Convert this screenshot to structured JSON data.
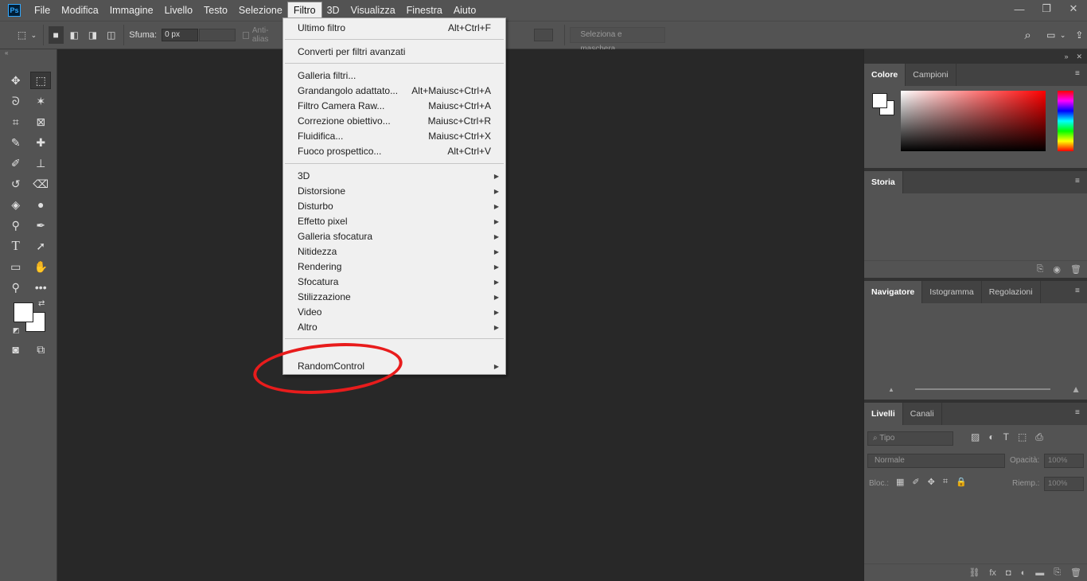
{
  "app": {
    "logo": "Ps"
  },
  "menubar": {
    "items": [
      "File",
      "Modifica",
      "Immagine",
      "Livello",
      "Testo",
      "Selezione",
      "Filtro",
      "3D",
      "Visualizza",
      "Finestra",
      "Aiuto"
    ],
    "active": "Filtro"
  },
  "options": {
    "sfuma_label": "Sfuma:",
    "sfuma_value": "0 px",
    "antialias_label": "Anti-alias",
    "select_mask_button": "Seleziona e maschera..."
  },
  "filter_menu": {
    "items": [
      {
        "label": "Ultimo filtro",
        "shortcut": "Alt+Ctrl+F"
      },
      {
        "label": "Converti per filtri avanzati",
        "shortcut": ""
      },
      {
        "label": "Galleria filtri...",
        "shortcut": ""
      },
      {
        "label": "Grandangolo adattato...",
        "shortcut": "Alt+Maiusc+Ctrl+A"
      },
      {
        "label": "Filtro Camera Raw...",
        "shortcut": "Maiusc+Ctrl+A"
      },
      {
        "label": "Correzione obiettivo...",
        "shortcut": "Maiusc+Ctrl+R"
      },
      {
        "label": "Fluidifica...",
        "shortcut": "Maiusc+Ctrl+X"
      },
      {
        "label": "Fuoco prospettico...",
        "shortcut": "Alt+Ctrl+V"
      },
      {
        "label": "3D",
        "shortcut": ""
      },
      {
        "label": "Distorsione",
        "shortcut": ""
      },
      {
        "label": "Disturbo",
        "shortcut": ""
      },
      {
        "label": "Effetto pixel",
        "shortcut": ""
      },
      {
        "label": "Galleria sfocatura",
        "shortcut": ""
      },
      {
        "label": "Nitidezza",
        "shortcut": ""
      },
      {
        "label": "Rendering",
        "shortcut": ""
      },
      {
        "label": "Sfocatura",
        "shortcut": ""
      },
      {
        "label": "Stilizzazione",
        "shortcut": ""
      },
      {
        "label": "Video",
        "shortcut": ""
      },
      {
        "label": "Altro",
        "shortcut": ""
      },
      {
        "label": "RandomControl",
        "shortcut": ""
      }
    ]
  },
  "panels": {
    "color": {
      "tabs": [
        "Colore",
        "Campioni"
      ]
    },
    "history": {
      "tabs": [
        "Storia"
      ]
    },
    "navigator": {
      "tabs": [
        "Navigatore",
        "Istogramma",
        "Regolazioni"
      ]
    },
    "layers": {
      "tabs": [
        "Livelli",
        "Canali"
      ],
      "search_placeholder": "Tipo",
      "blend_mode": "Normale",
      "opacity_label": "Opacità:",
      "opacity_value": "100%",
      "lock_label": "Bloc.:",
      "fill_label": "Riemp.:",
      "fill_value": "100%"
    }
  },
  "colors": {
    "accent_ps": "#31a8ff",
    "annotation": "#e81c1c"
  }
}
